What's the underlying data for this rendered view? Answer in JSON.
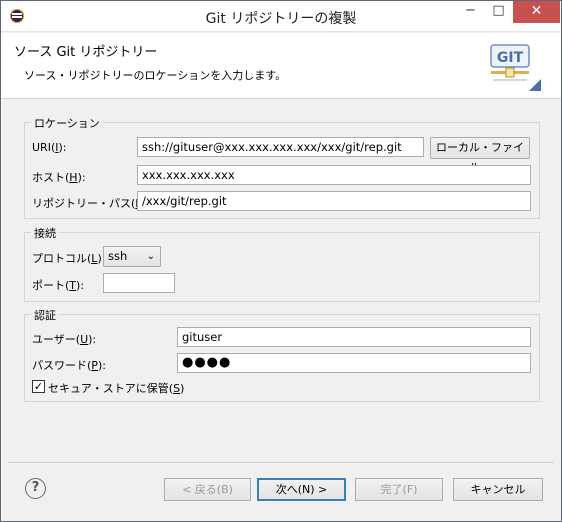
{
  "window": {
    "title": "Git リポジトリーの複製",
    "minimize": "−",
    "maximize": "□",
    "close": "✕"
  },
  "header": {
    "title": "ソース Git リポジトリー",
    "description": "ソース・リポジトリーのロケーションを入力します。",
    "logo_text": "GIT"
  },
  "location": {
    "group_label": "ロケーション",
    "uri_label": "URI(",
    "uri_key": "I",
    "uri_suffix": "):",
    "uri_value": "ssh://gituser@xxx.xxx.xxx.xxx/xxx/git/rep.git",
    "local_file_button": "ローカル・ファイル...",
    "host_label": "ホスト(",
    "host_key": "H",
    "host_suffix": "):",
    "host_value": "xxx.xxx.xxx.xxx",
    "path_label": "リポジトリー・パス(",
    "path_key": "R",
    "path_suffix": "):",
    "path_value": "/xxx/git/rep.git"
  },
  "connection": {
    "group_label": "接続",
    "protocol_label": "プロトコル(",
    "protocol_key": "L",
    "protocol_suffix": "):",
    "protocol_value": "ssh",
    "port_label": "ポート(",
    "port_key": "T",
    "port_suffix": "):",
    "port_value": ""
  },
  "auth": {
    "group_label": "認証",
    "user_label": "ユーザー(",
    "user_key": "U",
    "user_suffix": "):",
    "user_value": "gituser",
    "password_label": "パスワード(",
    "password_key": "P",
    "password_suffix": "):",
    "password_value": "●●●●",
    "store_label": "セキュア・ストアに保管(",
    "store_key": "S",
    "store_suffix": ")",
    "store_checked": "✓"
  },
  "footer": {
    "help": "?",
    "back_button": "< 戻る(B)",
    "next_button": "次へ(N) >",
    "finish_button": "完了(F)",
    "cancel_button": "キャンセル"
  },
  "colors": {
    "close_button": "#c75050",
    "default_button_border": "#3c7fb1",
    "logo_blue": "#4b6fa3",
    "logo_gold": "#d9b24a"
  }
}
